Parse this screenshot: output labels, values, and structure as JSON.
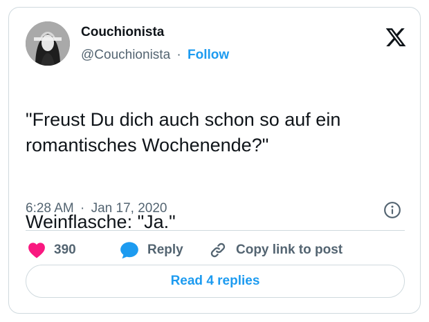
{
  "author": {
    "name": "Couchionista",
    "handle": "@Couchionista",
    "separator": "·",
    "follow_label": "Follow",
    "avatar_icon": "profile-photo-avatar"
  },
  "tweet": {
    "text_line1": "\"Freust Du dich auch schon so auf ein romantisches Wochenende?\"",
    "text_line2": "Weinflasche: \"Ja.\"",
    "time": "6:28 AM",
    "date_separator": "·",
    "date": "Jan 17, 2020"
  },
  "actions": {
    "like_count": "390",
    "reply_label": "Reply",
    "copy_label": "Copy link to post",
    "read_replies_label": "Read 4 replies"
  },
  "icons": {
    "brand": "x-logo-icon",
    "info": "info-icon",
    "like": "heart-icon",
    "reply": "speech-bubble-icon",
    "copy": "link-icon"
  },
  "colors": {
    "accent": "#1d9bf0",
    "heart": "#f91880",
    "text_primary": "#0f1419",
    "text_secondary": "#536471",
    "border": "#cfd9de"
  }
}
